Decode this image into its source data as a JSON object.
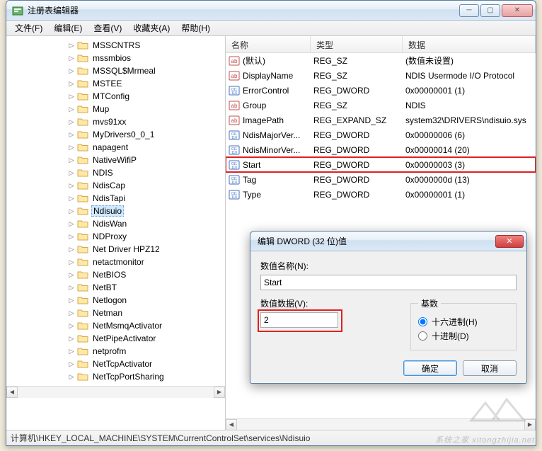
{
  "window": {
    "title": "注册表编辑器"
  },
  "menu": {
    "file": "文件(F)",
    "edit": "编辑(E)",
    "view": "查看(V)",
    "favorites": "收藏夹(A)",
    "help": "帮助(H)"
  },
  "tree": {
    "items": [
      "MSSCNTRS",
      "mssmbios",
      "MSSQL$Mrmeal",
      "MSTEE",
      "MTConfig",
      "Mup",
      "mvs91xx",
      "MyDrivers0_0_1",
      "napagent",
      "NativeWifiP",
      "NDIS",
      "NdisCap",
      "NdisTapi",
      "Ndisuio",
      "NdisWan",
      "NDProxy",
      "Net Driver HPZ12",
      "netactmonitor",
      "NetBIOS",
      "NetBT",
      "Netlogon",
      "Netman",
      "NetMsmqActivator",
      "NetPipeActivator",
      "netprofm",
      "NetTcpActivator",
      "NetTcpPortSharing"
    ],
    "selected_index": 13
  },
  "list": {
    "columns": {
      "name": "名称",
      "type": "类型",
      "data": "数据"
    },
    "rows": [
      {
        "icon": "sz",
        "name": "(默认)",
        "type": "REG_SZ",
        "data": "(数值未设置)"
      },
      {
        "icon": "sz",
        "name": "DisplayName",
        "type": "REG_SZ",
        "data": "NDIS Usermode I/O Protocol"
      },
      {
        "icon": "dw",
        "name": "ErrorControl",
        "type": "REG_DWORD",
        "data": "0x00000001 (1)"
      },
      {
        "icon": "sz",
        "name": "Group",
        "type": "REG_SZ",
        "data": "NDIS"
      },
      {
        "icon": "sz",
        "name": "ImagePath",
        "type": "REG_EXPAND_SZ",
        "data": "system32\\DRIVERS\\ndisuio.sys"
      },
      {
        "icon": "dw",
        "name": "NdisMajorVer...",
        "type": "REG_DWORD",
        "data": "0x00000006 (6)"
      },
      {
        "icon": "dw",
        "name": "NdisMinorVer...",
        "type": "REG_DWORD",
        "data": "0x00000014 (20)"
      },
      {
        "icon": "dw",
        "name": "Start",
        "type": "REG_DWORD",
        "data": "0x00000003 (3)",
        "highlight": true
      },
      {
        "icon": "dw",
        "name": "Tag",
        "type": "REG_DWORD",
        "data": "0x0000000d (13)"
      },
      {
        "icon": "dw",
        "name": "Type",
        "type": "REG_DWORD",
        "data": "0x00000001 (1)"
      }
    ]
  },
  "dialog": {
    "title": "编辑 DWORD (32 位)值",
    "name_label": "数值名称(N):",
    "name_value": "Start",
    "data_label": "数值数据(V):",
    "data_value": "2",
    "base_label": "基数",
    "radix_hex": "十六进制(H)",
    "radix_dec": "十进制(D)",
    "ok": "确定",
    "cancel": "取消"
  },
  "statusbar": {
    "path": "计算机\\HKEY_LOCAL_MACHINE\\SYSTEM\\CurrentControlSet\\services\\Ndisuio"
  },
  "watermark": {
    "text1": "系统之家",
    "text2": "xitongzhijia.net"
  }
}
